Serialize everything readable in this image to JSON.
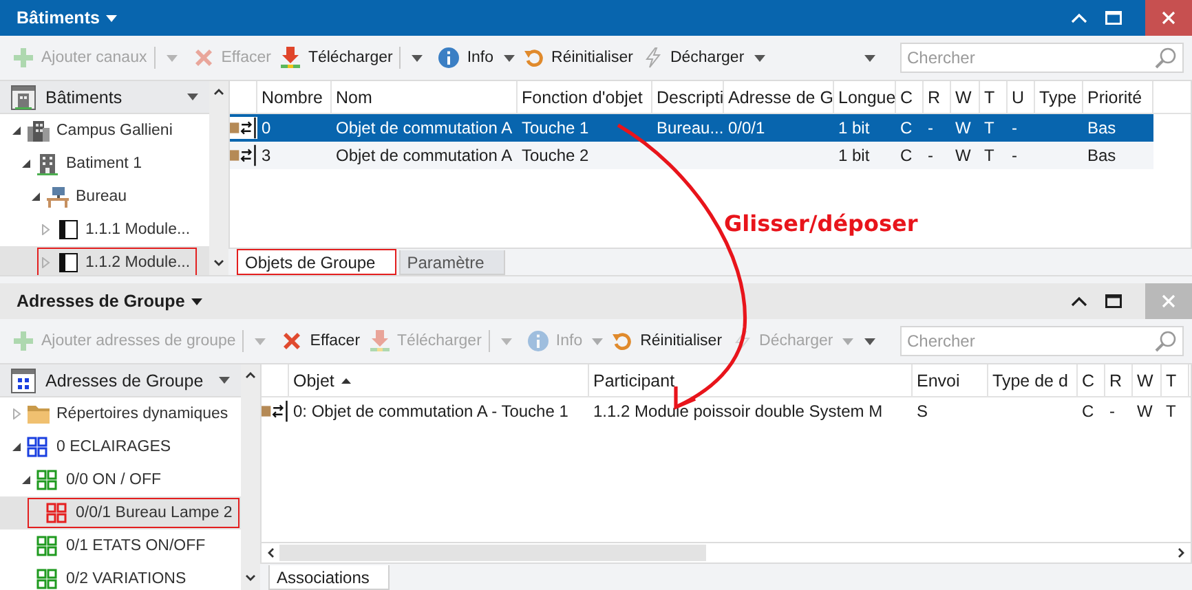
{
  "panels": [
    {
      "title": "Bâtiments",
      "active": true,
      "toolbar": [
        {
          "label": "Ajouter canaux",
          "kind": "add",
          "disabled": true,
          "split": true,
          "dropdown": false
        },
        {
          "label": "Effacer",
          "kind": "delete",
          "disabled": true,
          "split": false,
          "dropdown": false
        },
        {
          "label": "Télécharger",
          "kind": "download",
          "disabled": false,
          "split": true,
          "dropdown": false
        },
        {
          "label": "Info",
          "kind": "info",
          "disabled": false,
          "split": false,
          "dropdown": true
        },
        {
          "label": "Réinitialiser",
          "kind": "reset",
          "disabled": false,
          "split": false,
          "dropdown": false
        },
        {
          "label": "Décharger",
          "kind": "unload",
          "disabled": false,
          "split": false,
          "dropdown": true
        }
      ],
      "search": {
        "placeholder": "Chercher"
      },
      "tree": {
        "title": "Bâtiments",
        "kind": "buildings",
        "items": [
          {
            "label": "Campus Gallieni",
            "kind": "campus",
            "expanded": true,
            "selected": false,
            "highlighted": false,
            "children": [
              {
                "label": "Batiment 1",
                "kind": "building",
                "expanded": true,
                "selected": false,
                "highlighted": false,
                "children": [
                  {
                    "label": "Bureau",
                    "kind": "room",
                    "expanded": true,
                    "selected": false,
                    "highlighted": false,
                    "children": [
                      {
                        "label": "1.1.1 Module...",
                        "kind": "device",
                        "expanded": false,
                        "selected": false,
                        "highlighted": false
                      },
                      {
                        "label": "1.1.2 Module...",
                        "kind": "device",
                        "expanded": false,
                        "selected": true,
                        "highlighted": true
                      }
                    ]
                  }
                ]
              }
            ]
          }
        ]
      },
      "table": {
        "columns": [
          {
            "label": "Nombre"
          },
          {
            "label": "Nom"
          },
          {
            "label": "Fonction d'objet"
          },
          {
            "label": "Descripti"
          },
          {
            "label": "Adresse de G"
          },
          {
            "label": "Longue"
          },
          {
            "label": "C"
          },
          {
            "label": "R"
          },
          {
            "label": "W"
          },
          {
            "label": "T"
          },
          {
            "label": "U"
          },
          {
            "label": "Type"
          },
          {
            "label": "Priorité"
          }
        ],
        "rows": [
          {
            "selected": true,
            "cells": [
              "0",
              "Objet de commutation A",
              "Touche 1",
              "Bureau...",
              "0/0/1",
              "1 bit",
              "C",
              "-",
              "W",
              "T",
              "-",
              "",
              "Bas"
            ]
          },
          {
            "selected": false,
            "cells": [
              "3",
              "Objet de commutation A",
              "Touche 2",
              "",
              "",
              "1 bit",
              "C",
              "-",
              "W",
              "T",
              "-",
              "",
              "Bas"
            ]
          }
        ]
      },
      "tabs": [
        {
          "label": "Objets de Groupe",
          "selected": true,
          "highlighted": true
        },
        {
          "label": "Paramètre",
          "selected": false,
          "highlighted": false
        }
      ]
    },
    {
      "title": "Adresses de Groupe",
      "active": false,
      "toolbar": [
        {
          "label": "Ajouter adresses de groupe",
          "kind": "add",
          "disabled": true,
          "split": true,
          "dropdown": false
        },
        {
          "label": "Effacer",
          "kind": "delete",
          "disabled": false,
          "split": false,
          "dropdown": false
        },
        {
          "label": "Télécharger",
          "kind": "download",
          "disabled": true,
          "split": true,
          "dropdown": false
        },
        {
          "label": "Info",
          "kind": "info",
          "disabled": true,
          "split": false,
          "dropdown": true
        },
        {
          "label": "Réinitialiser",
          "kind": "reset",
          "disabled": false,
          "split": false,
          "dropdown": false
        },
        {
          "label": "Décharger",
          "kind": "unload",
          "disabled": true,
          "split": false,
          "dropdown": true
        }
      ],
      "search": {
        "placeholder": "Chercher"
      },
      "tree": {
        "title": "Adresses de Groupe",
        "kind": "groups",
        "items": [
          {
            "label": "Répertoires dynamiques",
            "kind": "folder",
            "expanded": false,
            "selected": false,
            "highlighted": false
          },
          {
            "label": "0 ECLAIRAGES",
            "kind": "main-group",
            "expanded": true,
            "selected": false,
            "highlighted": false,
            "children": [
              {
                "label": "0/0 ON / OFF",
                "kind": "middle-group",
                "expanded": true,
                "selected": false,
                "highlighted": false,
                "children": [
                  {
                    "label": "0/0/1 Bureau Lampe 2",
                    "kind": "group-address",
                    "selected": true,
                    "highlighted": true
                  }
                ]
              },
              {
                "label": "0/1 ETATS ON/OFF",
                "kind": "middle-group",
                "selected": false,
                "highlighted": false
              },
              {
                "label": "0/2 VARIATIONS",
                "kind": "middle-group",
                "selected": false,
                "highlighted": false
              }
            ]
          }
        ]
      },
      "table": {
        "columns": [
          {
            "label": "Objet",
            "sorted": true
          },
          {
            "label": "Participant",
            "sorted": false
          },
          {
            "label": "Envoi",
            "sorted": false
          },
          {
            "label": "Type de d",
            "sorted": false
          },
          {
            "label": "C",
            "sorted": false
          },
          {
            "label": "R",
            "sorted": false
          },
          {
            "label": "W",
            "sorted": false
          },
          {
            "label": "T",
            "sorted": false
          }
        ],
        "rows": [
          {
            "selected": false,
            "cells": [
              "0: Objet de commutation A - Touche 1",
              "1.1.2 Module poissoir double System M",
              "S",
              "",
              "C",
              "-",
              "W",
              "T"
            ]
          }
        ]
      },
      "tabs": [
        {
          "label": "Associations",
          "selected": true,
          "highlighted": false
        }
      ]
    }
  ],
  "annotation": {
    "label": "Glisser/déposer"
  }
}
